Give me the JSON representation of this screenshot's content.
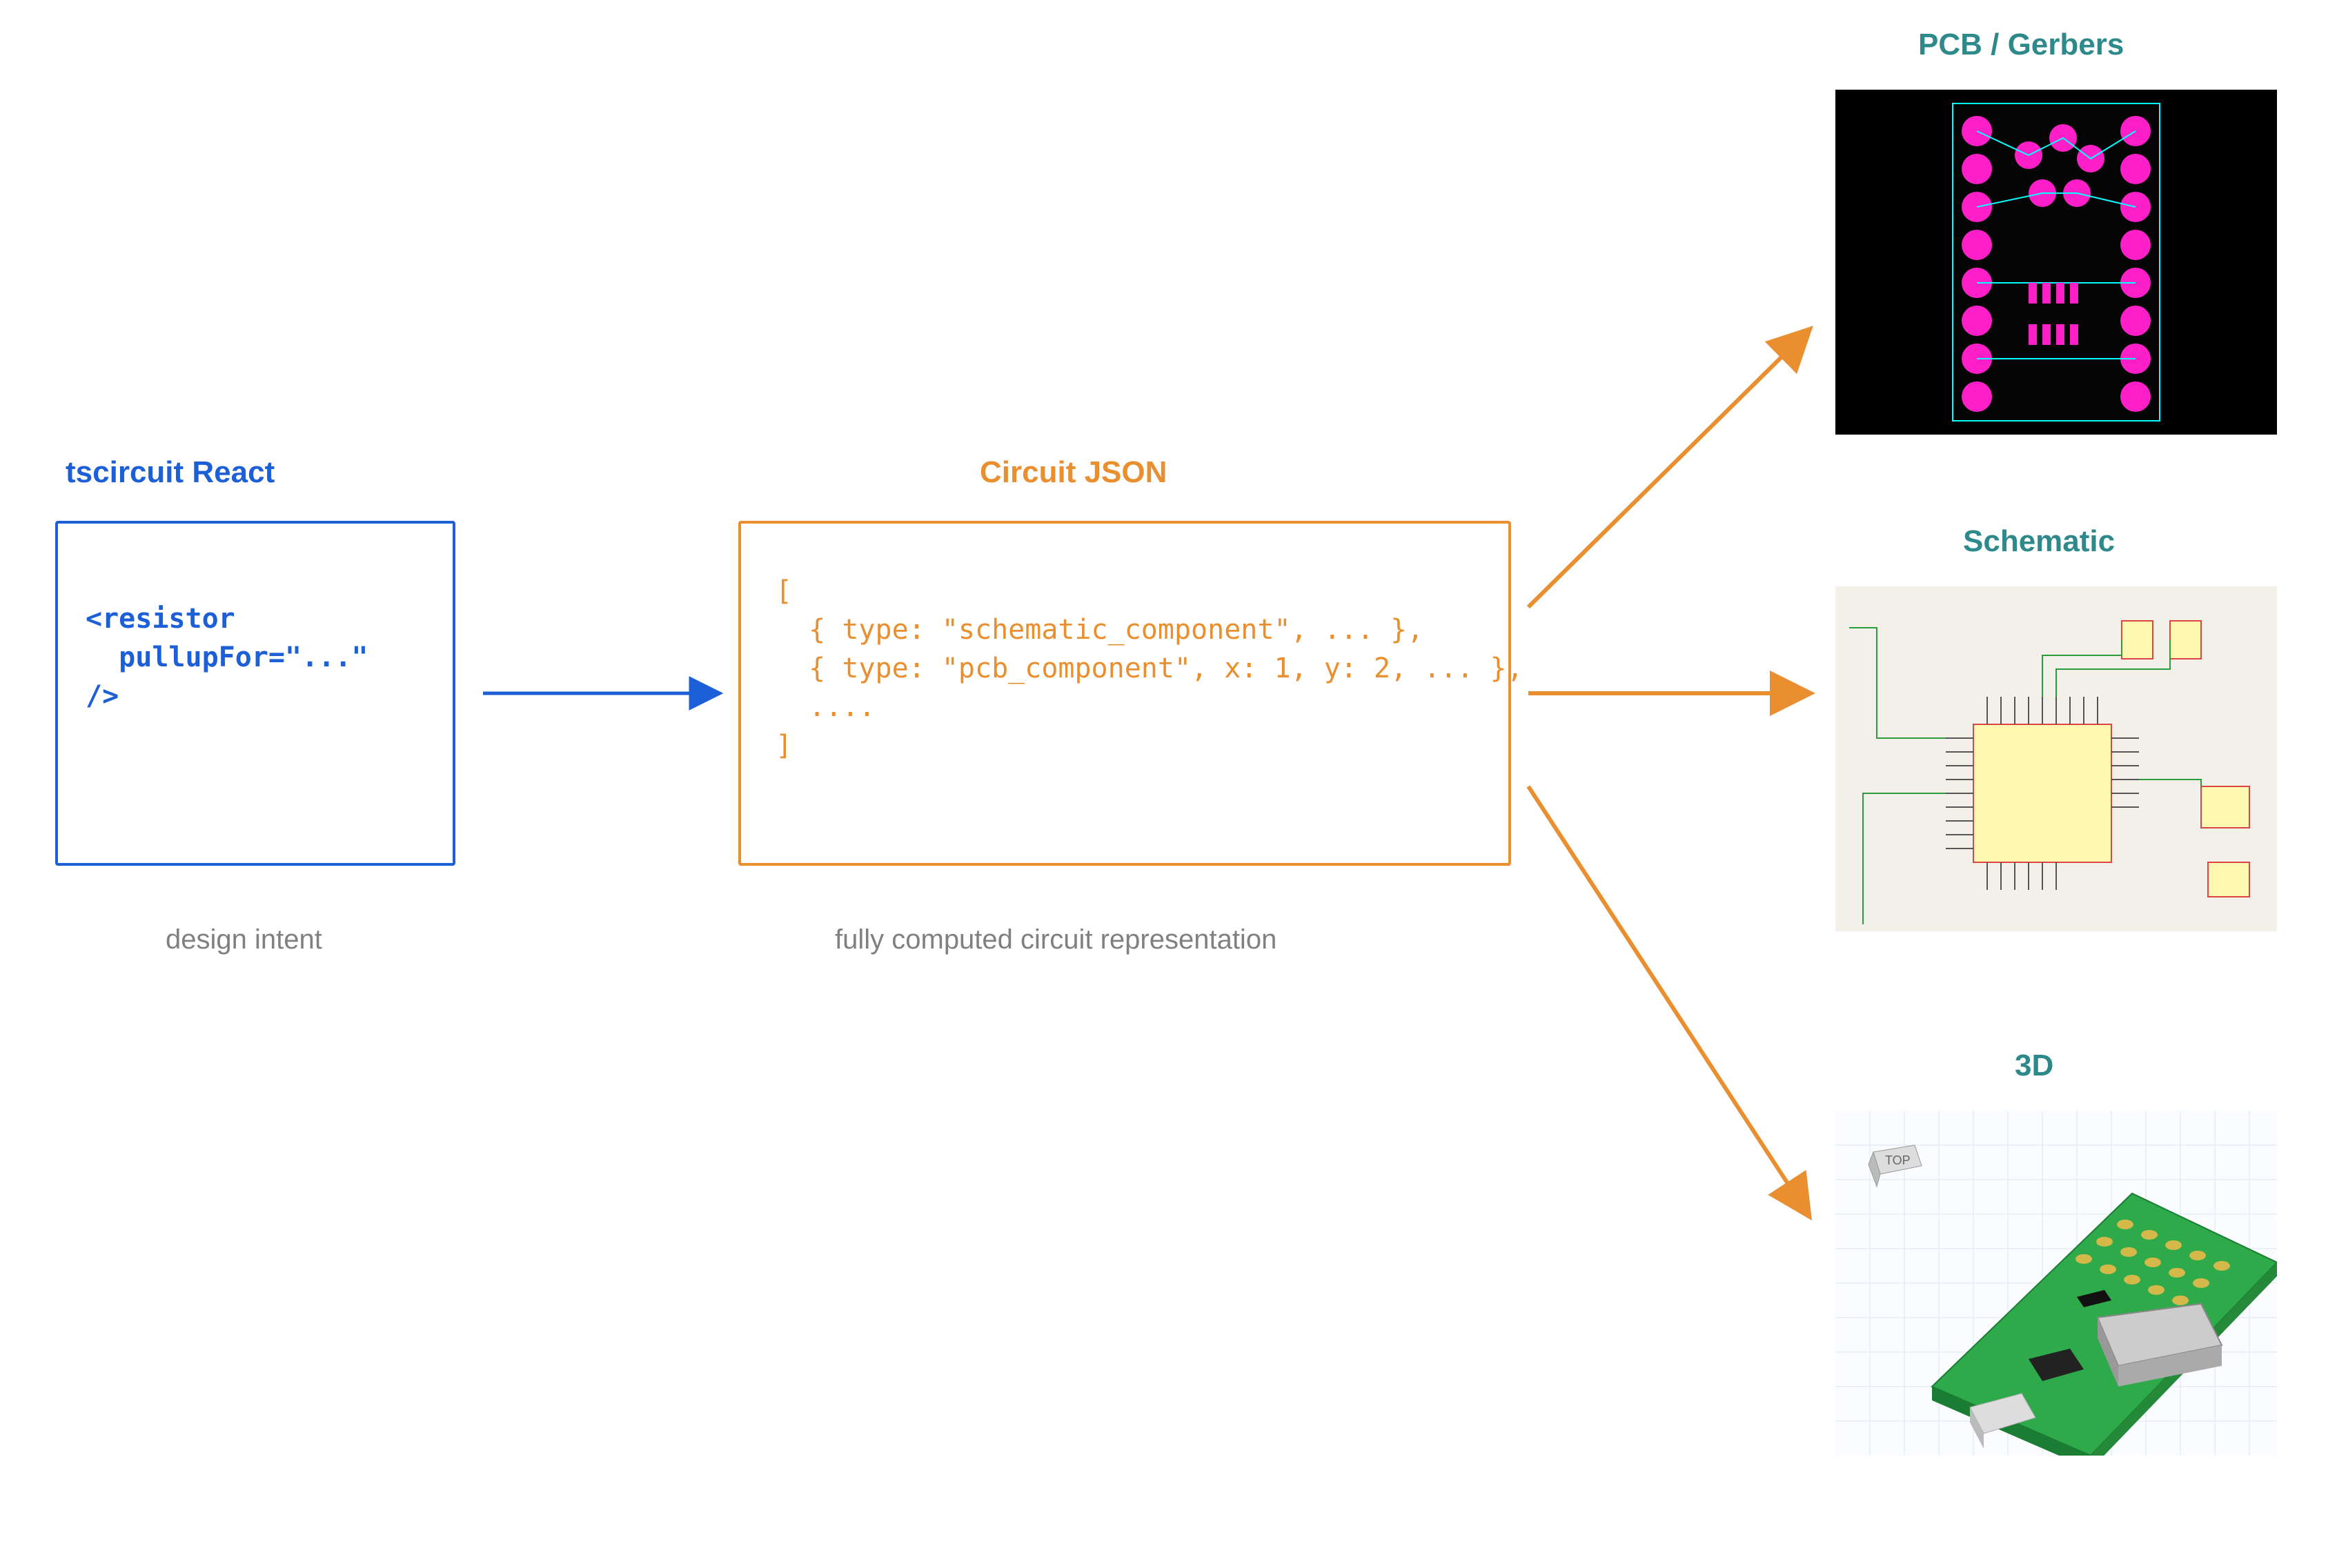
{
  "colors": {
    "blue": "#1d5fd6",
    "orange": "#e98f2f",
    "teal": "#2e8a8a",
    "gray": "#808080"
  },
  "react_block": {
    "title": "tscircuit React",
    "code": "<resistor\n  pullupFor=\"...\"\n/>",
    "caption": "design intent"
  },
  "json_block": {
    "title": "Circuit JSON",
    "code": "[\n  { type: \"schematic_component\", ... },\n  { type: \"pcb_component\", x: 1, y: 2, ... },\n  ....\n]",
    "caption": "fully computed circuit representation"
  },
  "outputs": {
    "pcb_title": "PCB / Gerbers",
    "schematic_title": "Schematic",
    "three_d_title": "3D"
  }
}
